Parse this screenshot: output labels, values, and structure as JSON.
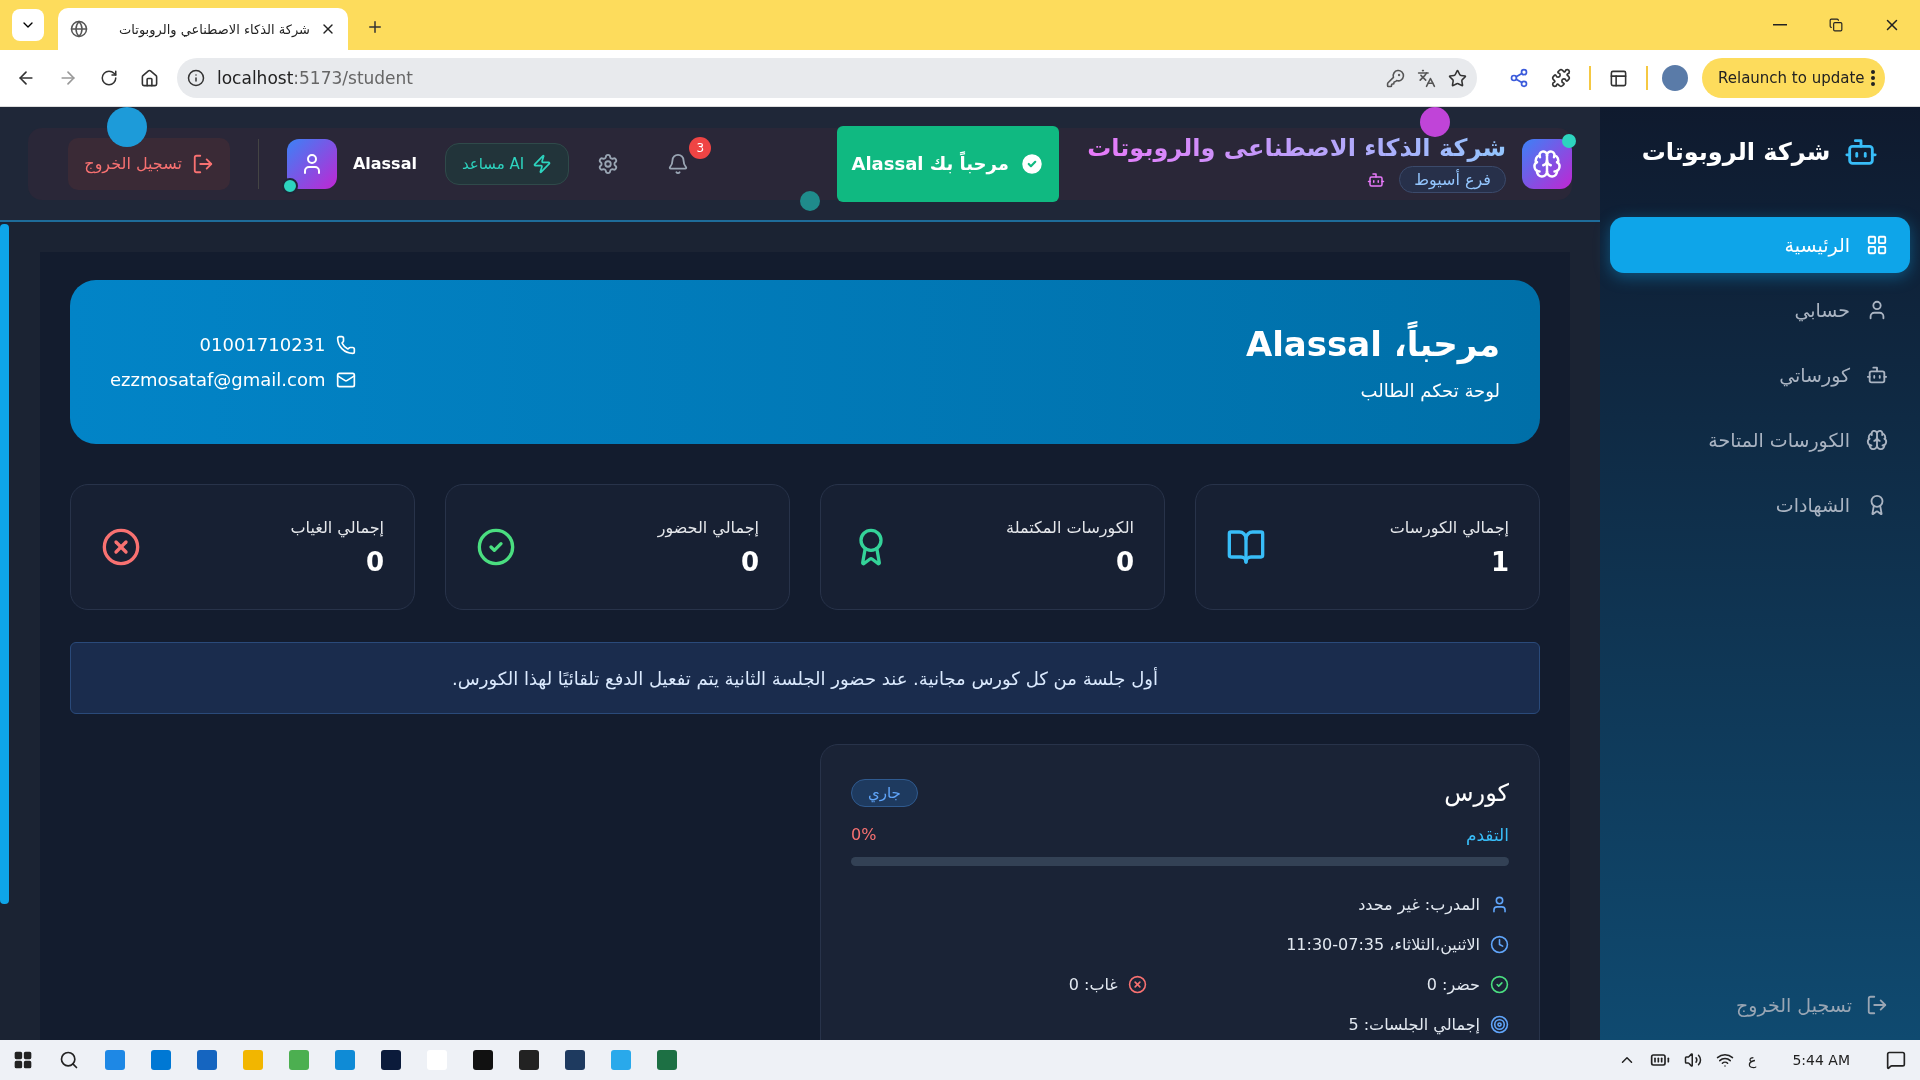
{
  "browser": {
    "tab_title": "شركة الذكاء الاصطناعي والروبوتات",
    "url_host": "localhost",
    "url_path": ":5173/student",
    "relaunch": "Relaunch to update"
  },
  "header": {
    "brand_title": "شركة الذكاء الاصطناعى والروبوتات",
    "branch": "فرع أسيوط",
    "toast": "مرحباً بك Alassal",
    "notifications": "3",
    "ai_button": "AI مساعد",
    "user_name": "Alassal",
    "logout": "تسجيل الخروج"
  },
  "sidebar": {
    "title": "شركة الروبوتات",
    "items": [
      {
        "label": "الرئيسية",
        "kind": "home",
        "selected": true
      },
      {
        "label": "حسابي",
        "kind": "account",
        "selected": false
      },
      {
        "label": "كورساتي",
        "kind": "courses",
        "selected": false
      },
      {
        "label": "الكورسات المتاحة",
        "kind": "available",
        "selected": false
      },
      {
        "label": "الشهادات",
        "kind": "certificates",
        "selected": false
      }
    ],
    "logout": "تسجيل الخروج"
  },
  "welcome": {
    "greeting": "مرحباً، Alassal",
    "subtitle": "لوحة تحكم الطالب",
    "phone": "01001710231",
    "email": "ezzmosataf@gmail.com"
  },
  "stats": [
    {
      "kind": "courses",
      "label": "إجمالي الكورسات",
      "value": "1"
    },
    {
      "kind": "completed",
      "label": "الكورسات المكتملة",
      "value": "0"
    },
    {
      "kind": "present",
      "label": "إجمالي الحضور",
      "value": "0"
    },
    {
      "kind": "absent",
      "label": "إجمالي الغياب",
      "value": "0"
    }
  ],
  "notice": "أول جلسة من كل كورس مجانية. عند حضور الجلسة الثانية يتم تفعيل الدفع تلقائيًا لهذا الكورس.",
  "course": {
    "title": "كورس",
    "status": "جاري",
    "progress_label": "التقدم",
    "progress_value": "0%",
    "level": 0,
    "rows": [
      {
        "kind": "instructor",
        "text": "المدرب: غير محدد"
      },
      {
        "kind": "schedule",
        "text": "الاثنين،الثلاثاء، 07:35-11:30"
      },
      {
        "kind": "attendance",
        "present": "حضر: 0",
        "absent": "غاب: 0"
      },
      {
        "kind": "sessions",
        "text": "إجمالي الجلسات: 5"
      }
    ]
  },
  "taskbar": {
    "language": "ع",
    "time": "5:44 AM"
  }
}
